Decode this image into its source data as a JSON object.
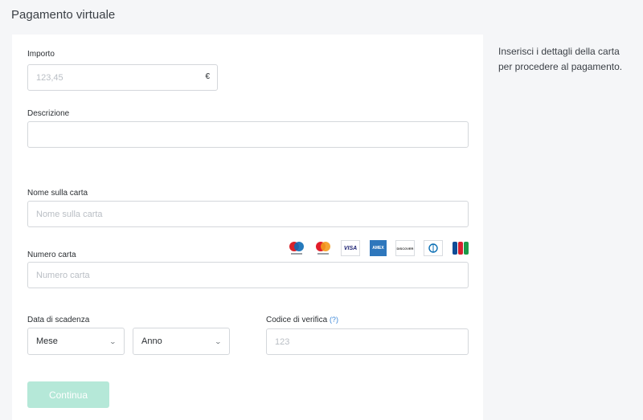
{
  "page": {
    "title": "Pagamento virtuale"
  },
  "side_note": "Inserisci i dettagli della carta per procedere al pagamento.",
  "form": {
    "amount": {
      "label": "Importo",
      "placeholder": "123,45",
      "currency": "€"
    },
    "description": {
      "label": "Descrizione",
      "value": ""
    },
    "card_name": {
      "label": "Nome sulla carta",
      "placeholder": "Nome sulla carta"
    },
    "card_number": {
      "label": "Numero carta",
      "placeholder": "Numero carta"
    },
    "expiry": {
      "label": "Data di scadenza",
      "month": "Mese",
      "year": "Anno"
    },
    "cvv": {
      "label": "Codice di verifica",
      "help": "(?)",
      "placeholder": "123"
    },
    "submit_label": "Continua"
  },
  "card_logos": [
    {
      "name": "maestro-icon",
      "text": ""
    },
    {
      "name": "mastercard-icon",
      "text": ""
    },
    {
      "name": "visa-icon",
      "text": "VISA"
    },
    {
      "name": "american-express-icon",
      "text": "AMEX"
    },
    {
      "name": "discover-icon",
      "text": "DISCOVER"
    },
    {
      "name": "diners-club-icon",
      "text": ""
    },
    {
      "name": "jcb-icon",
      "text": "JCB"
    }
  ],
  "colors": {
    "button": "#b5e8d8",
    "link": "#3a86d8",
    "border": "#d4d7db",
    "background": "#f5f6f8"
  }
}
